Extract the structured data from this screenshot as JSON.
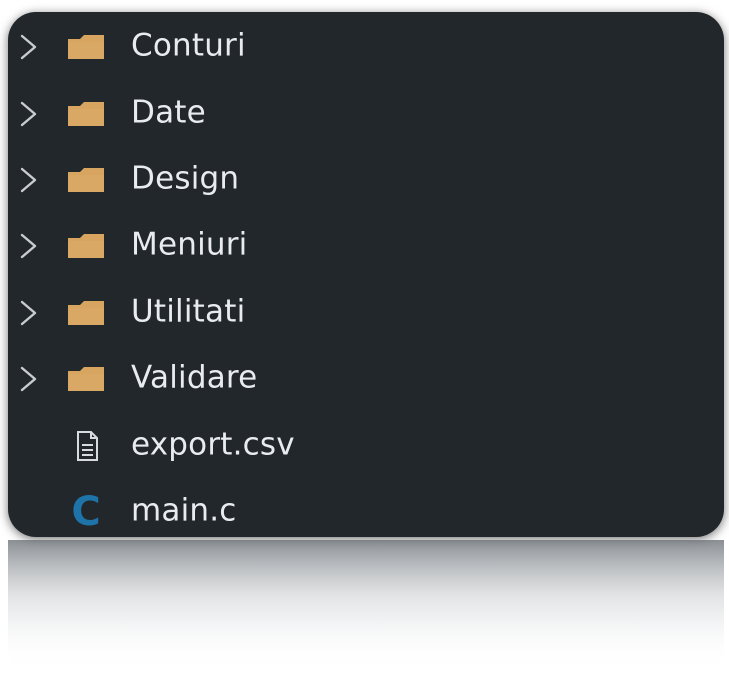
{
  "explorer": {
    "items": [
      {
        "type": "folder",
        "label": "Conturi",
        "icon": "folder-icon"
      },
      {
        "type": "folder",
        "label": "Date",
        "icon": "folder-icon"
      },
      {
        "type": "folder",
        "label": "Design",
        "icon": "folder-icon"
      },
      {
        "type": "folder",
        "label": "Meniuri",
        "icon": "folder-icon"
      },
      {
        "type": "folder",
        "label": "Utilitati",
        "icon": "folder-icon"
      },
      {
        "type": "folder",
        "label": "Validare",
        "icon": "folder-icon"
      },
      {
        "type": "file",
        "label": "export.csv",
        "icon": "file-text-icon"
      },
      {
        "type": "file",
        "label": "main.c",
        "icon": "c-language-icon",
        "glyph": "C"
      }
    ]
  },
  "colors": {
    "background": "#22272b",
    "text": "#e9ecef",
    "folder": "#d7a55f",
    "c_icon": "#1e73a8",
    "chevron": "#c8ccd0"
  }
}
